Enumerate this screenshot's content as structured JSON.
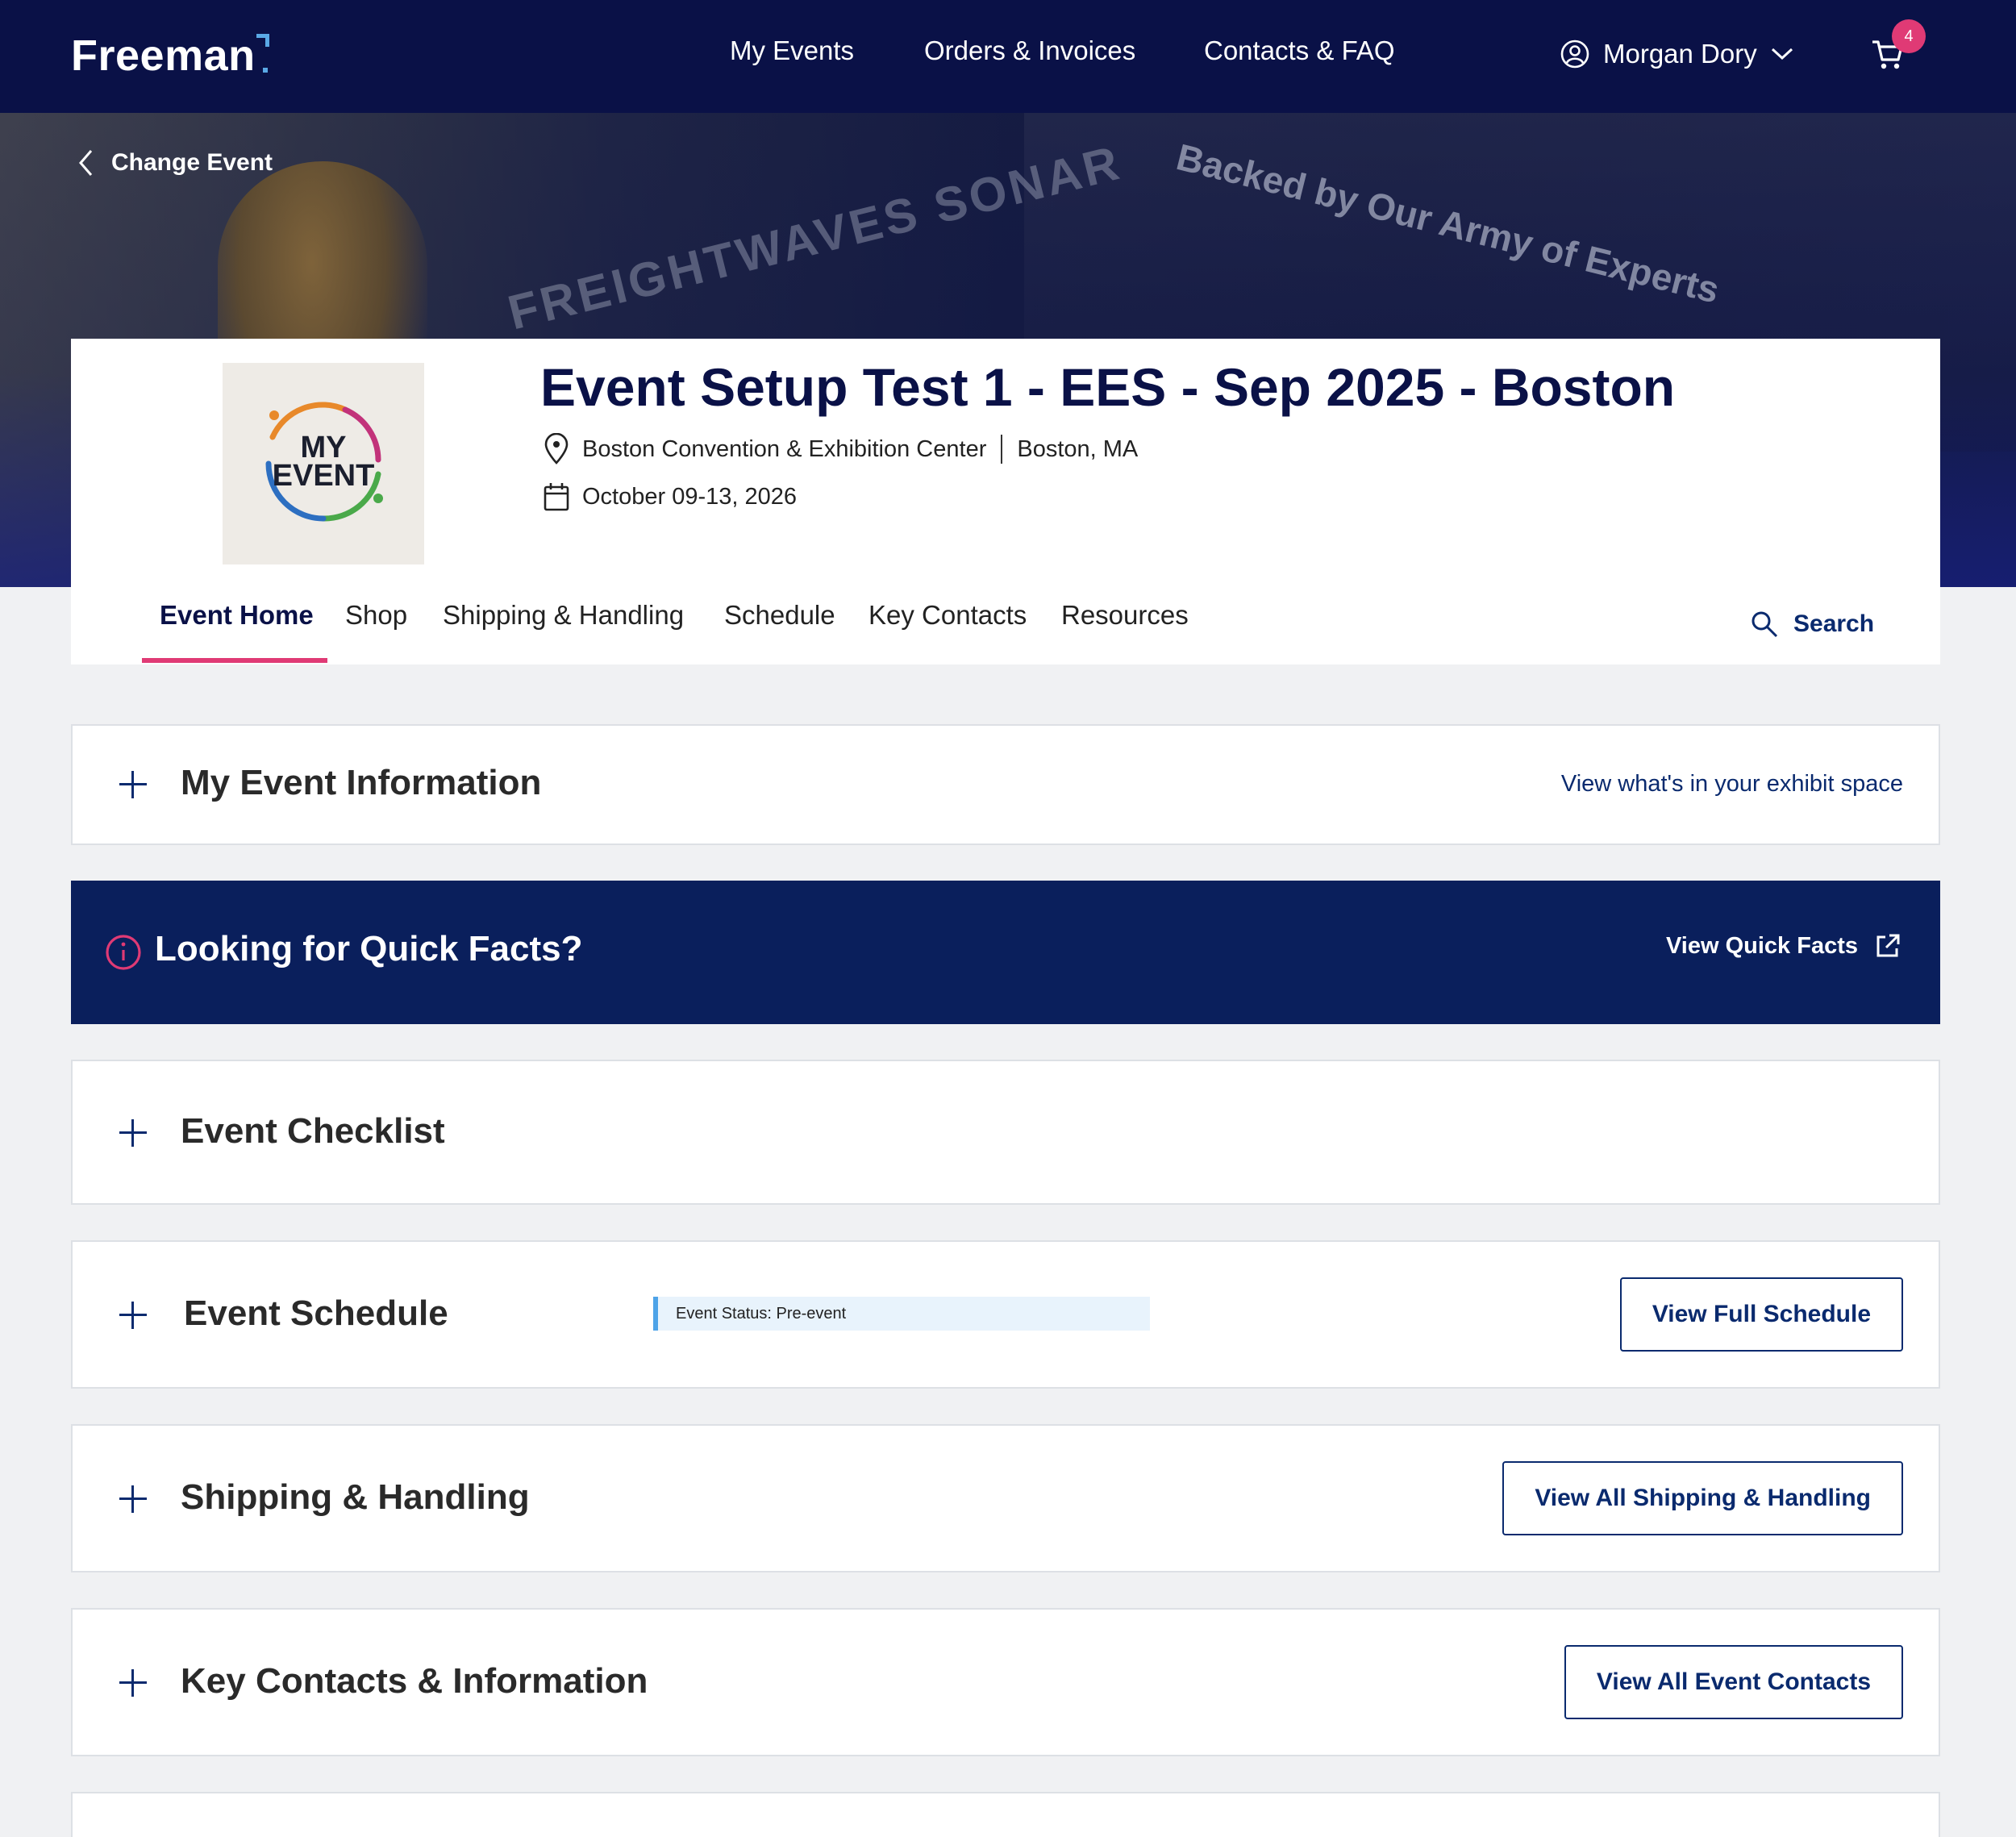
{
  "topnav": {
    "logo": "Freeman",
    "links": [
      "My Events",
      "Orders & Invoices",
      "Contacts & FAQ"
    ],
    "user_name": "Morgan Dory",
    "cart_count": "4"
  },
  "hero": {
    "change_event": "Change Event",
    "banner_text_1": "FREIGHTWAVES SONAR",
    "banner_text_2": "Backed by Our Army of Experts"
  },
  "event": {
    "logo_line_1": "MY",
    "logo_line_2": "EVENT",
    "title": "Event Setup Test 1 - EES - Sep 2025 - Boston",
    "venue": "Boston Convention & Exhibition Center",
    "city": "Boston, MA",
    "dates": "October 09-13, 2026"
  },
  "tabs": {
    "items": [
      "Event Home",
      "Shop",
      "Shipping & Handling",
      "Schedule",
      "Key Contacts",
      "Resources"
    ],
    "active": "Event Home",
    "search_label": "Search"
  },
  "sections": {
    "my_event_info": {
      "title": "My Event Information",
      "link": "View what's in your exhibit space"
    },
    "quick_facts": {
      "title": "Looking for Quick Facts?",
      "link": "View Quick Facts"
    },
    "checklist": {
      "title": "Event Checklist"
    },
    "schedule": {
      "title": "Event Schedule",
      "status": "Event Status: Pre-event",
      "button": "View Full Schedule"
    },
    "shipping": {
      "title": "Shipping & Handling",
      "button": "View All Shipping & Handling"
    },
    "contacts": {
      "title": "Key Contacts & Information",
      "button": "View All Event Contacts"
    }
  },
  "colors": {
    "navy": "#0a1147",
    "accent_pink": "#e03a75",
    "link_blue": "#0a2a6e",
    "status_blue": "#4da3e8"
  }
}
